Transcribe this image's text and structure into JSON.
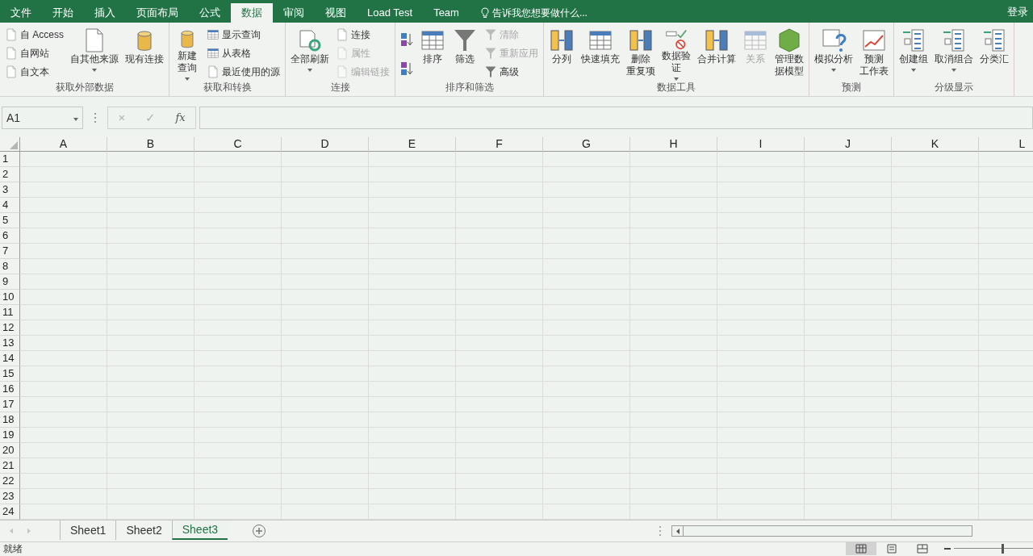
{
  "title_bar": {
    "tabs": [
      {
        "label": "文件",
        "selected": false
      },
      {
        "label": "开始",
        "selected": false
      },
      {
        "label": "插入",
        "selected": false
      },
      {
        "label": "页面布局",
        "selected": false
      },
      {
        "label": "公式",
        "selected": false
      },
      {
        "label": "数据",
        "selected": true
      },
      {
        "label": "审阅",
        "selected": false
      },
      {
        "label": "视图",
        "selected": false
      },
      {
        "label": "Load Test",
        "selected": false
      },
      {
        "label": "Team",
        "selected": false
      }
    ],
    "tell_me": "告诉我您想要做什么...",
    "sign_in": "登录"
  },
  "ribbon": {
    "groups": [
      {
        "label": "获取外部数据",
        "controls": [
          {
            "kind": "stack",
            "items": [
              {
                "label": "自 Access",
                "disabled": false
              },
              {
                "label": "自网站",
                "disabled": false
              },
              {
                "label": "自文本",
                "disabled": false
              }
            ]
          },
          {
            "kind": "large",
            "lines": [
              "自其他来源"
            ],
            "dropdown": true,
            "disabled": false
          },
          {
            "kind": "large",
            "lines": [
              "现有连接"
            ],
            "dropdown": false,
            "disabled": false
          }
        ]
      },
      {
        "label": "获取和转换",
        "controls": [
          {
            "kind": "large",
            "lines": [
              "新建",
              "查询"
            ],
            "dropdown": true,
            "disabled": false
          },
          {
            "kind": "stack",
            "items": [
              {
                "label": "显示查询",
                "disabled": false
              },
              {
                "label": "从表格",
                "disabled": false
              },
              {
                "label": "最近使用的源",
                "disabled": false
              }
            ]
          }
        ]
      },
      {
        "label": "连接",
        "controls": [
          {
            "kind": "large",
            "lines": [
              "全部刷新"
            ],
            "dropdown": true,
            "disabled": false
          },
          {
            "kind": "stack",
            "items": [
              {
                "label": "连接",
                "disabled": false
              },
              {
                "label": "属性",
                "disabled": true
              },
              {
                "label": "编辑链接",
                "disabled": true
              }
            ]
          }
        ]
      },
      {
        "label": "排序和筛选",
        "controls": [
          {
            "kind": "sort"
          },
          {
            "kind": "large",
            "lines": [
              "排序"
            ],
            "dropdown": false,
            "disabled": false
          },
          {
            "kind": "large",
            "lines": [
              "筛选"
            ],
            "dropdown": false,
            "disabled": false
          },
          {
            "kind": "stack",
            "items": [
              {
                "label": "清除",
                "disabled": true
              },
              {
                "label": "重新应用",
                "disabled": true
              },
              {
                "label": "高级",
                "disabled": false
              }
            ]
          }
        ]
      },
      {
        "label": "数据工具",
        "controls": [
          {
            "kind": "large",
            "lines": [
              "分列"
            ],
            "dropdown": false,
            "disabled": false
          },
          {
            "kind": "large",
            "lines": [
              "快速填充"
            ],
            "dropdown": false,
            "disabled": false
          },
          {
            "kind": "large",
            "lines": [
              "删除",
              "重复项"
            ],
            "dropdown": false,
            "disabled": false
          },
          {
            "kind": "large",
            "lines": [
              "数据验",
              "证"
            ],
            "dropdown": true,
            "disabled": false
          },
          {
            "kind": "large",
            "lines": [
              "合并计算"
            ],
            "dropdown": false,
            "disabled": false
          },
          {
            "kind": "large",
            "lines": [
              "关系"
            ],
            "dropdown": false,
            "disabled": true
          },
          {
            "kind": "large",
            "lines": [
              "管理数",
              "据模型"
            ],
            "dropdown": false,
            "disabled": false
          }
        ]
      },
      {
        "label": "预测",
        "controls": [
          {
            "kind": "large",
            "lines": [
              "模拟分析"
            ],
            "dropdown": true,
            "disabled": false
          },
          {
            "kind": "large",
            "lines": [
              "预测",
              "工作表"
            ],
            "dropdown": false,
            "disabled": false
          }
        ]
      },
      {
        "label": "分级显示",
        "controls": [
          {
            "kind": "large",
            "lines": [
              "创建组"
            ],
            "dropdown": true,
            "disabled": false
          },
          {
            "kind": "large",
            "lines": [
              "取消组合"
            ],
            "dropdown": true,
            "disabled": false
          },
          {
            "kind": "large",
            "lines": [
              "分类汇"
            ],
            "dropdown": false,
            "disabled": false
          }
        ]
      }
    ]
  },
  "formula_bar": {
    "name_box": "A1",
    "cancel": "×",
    "enter": "✓",
    "function": "fx"
  },
  "columns": [
    "A",
    "B",
    "C",
    "D",
    "E",
    "F",
    "G",
    "H",
    "I",
    "J",
    "K",
    "L"
  ],
  "rows": [
    "1",
    "2",
    "3",
    "4",
    "5",
    "6",
    "7",
    "8",
    "9",
    "10",
    "11",
    "12",
    "13",
    "14",
    "15",
    "16",
    "17",
    "18",
    "19",
    "20",
    "21",
    "22",
    "23",
    "24"
  ],
  "sheet_tabs": [
    {
      "label": "Sheet1",
      "selected": false
    },
    {
      "label": "Sheet2",
      "selected": false
    },
    {
      "label": "Sheet3",
      "selected": true
    }
  ],
  "status_bar": {
    "text": "就绪",
    "views": [
      {
        "selected": true
      },
      {
        "selected": false
      },
      {
        "selected": false
      }
    ],
    "zoom_slider": {
      "level": 0.6
    }
  }
}
